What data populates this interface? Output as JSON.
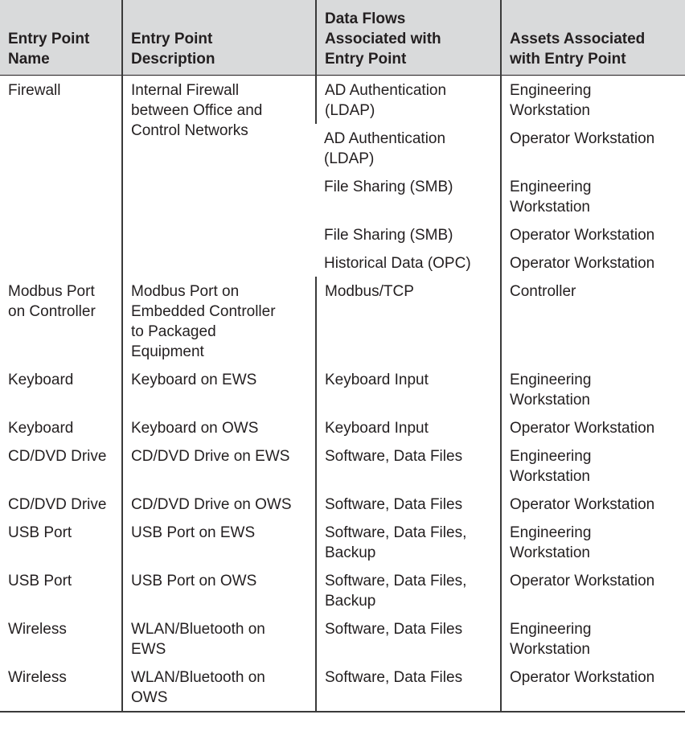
{
  "headers": [
    "Entry Point\nName",
    "Entry Point\nDescription",
    "Data Flows\nAssociated with\nEntry Point",
    "Assets Associated\nwith Entry Point"
  ],
  "rows": [
    {
      "name": "Firewall",
      "desc": "Internal Firewall\nbetween Office and\nControl Networks",
      "flows": [
        {
          "flow": "AD Authentication\n(LDAP)",
          "asset": "Engineering\nWorkstation"
        },
        {
          "flow": "AD Authentication\n(LDAP)",
          "asset": "Operator Workstation"
        },
        {
          "flow": "File Sharing (SMB)",
          "asset": "Engineering\nWorkstation"
        },
        {
          "flow": "File Sharing (SMB)",
          "asset": "Operator Workstation"
        },
        {
          "flow": "Historical Data (OPC)",
          "asset": "Operator Workstation"
        }
      ]
    },
    {
      "name": "Modbus Port\non Controller",
      "desc": "Modbus Port on\nEmbedded Controller\nto Packaged\nEquipment",
      "flows": [
        {
          "flow": "Modbus/TCP",
          "asset": "Controller"
        }
      ]
    },
    {
      "name": "Keyboard",
      "desc": "Keyboard on EWS",
      "flows": [
        {
          "flow": "Keyboard Input",
          "asset": "Engineering\nWorkstation"
        }
      ]
    },
    {
      "name": "Keyboard",
      "desc": "Keyboard on OWS",
      "flows": [
        {
          "flow": "Keyboard Input",
          "asset": "Operator Workstation"
        }
      ]
    },
    {
      "name": "CD/DVD Drive",
      "desc": "CD/DVD Drive on EWS",
      "flows": [
        {
          "flow": "Software, Data Files",
          "asset": "Engineering\nWorkstation"
        }
      ]
    },
    {
      "name": "CD/DVD Drive",
      "desc": "CD/DVD Drive on OWS",
      "flows": [
        {
          "flow": "Software, Data Files",
          "asset": "Operator Workstation"
        }
      ]
    },
    {
      "name": "USB Port",
      "desc": "USB Port on EWS",
      "flows": [
        {
          "flow": "Software, Data Files,\nBackup",
          "asset": "Engineering\nWorkstation"
        }
      ]
    },
    {
      "name": "USB Port",
      "desc": "USB Port on OWS",
      "flows": [
        {
          "flow": "Software, Data Files,\nBackup",
          "asset": "Operator Workstation"
        }
      ]
    },
    {
      "name": "Wireless",
      "desc": "WLAN/Bluetooth on\nEWS",
      "flows": [
        {
          "flow": "Software, Data Files",
          "asset": "Engineering\nWorkstation"
        }
      ]
    },
    {
      "name": "Wireless",
      "desc": "WLAN/Bluetooth on\nOWS",
      "flows": [
        {
          "flow": "Software, Data Files",
          "asset": "Operator Workstation"
        }
      ]
    }
  ]
}
